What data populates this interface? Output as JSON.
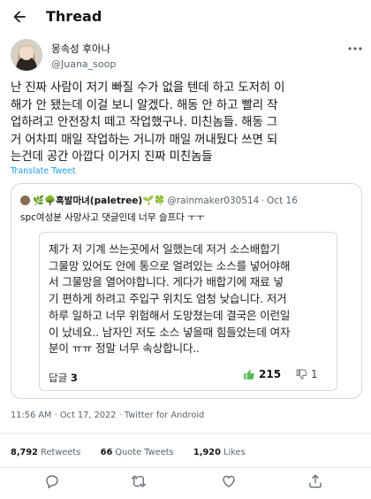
{
  "header": {
    "title": "Thread",
    "back_icon": "arrow-left-icon"
  },
  "author": {
    "display_name": "몽속성 후아나",
    "handle": "@Juana_soop"
  },
  "tweet": {
    "lines": [
      "난 진짜 사람이 저기 빠질 수가 없을 텐데 하고 도저히 이",
      "해가 안 됐는데 이걸 보니 알겠다. 해동 안 하고 빨리 작",
      "업하려고 안전장치 떼고 작업했구나. 미친놈들. 해동 그",
      "거 어차피 매일 작업하는 거니까 매일 꺼내뒀다 쓰면 되",
      "는건데 공간 아깝다 이거지 진짜 미친놈들"
    ],
    "translate_label": "Translate Tweet"
  },
  "quote": {
    "name": "🌿🌳흑발마녀(paletree)🌱🍀",
    "handle": "@rainmaker030514",
    "date": "· Oct 16",
    "text": "spc여성분 사망사고 댓글인데 너무 슬프다 ㅜㅜ",
    "card": {
      "lines": [
        "제가 저 기계 쓰는곳에서 일했는데 저거 소스배합기",
        "그물망 있어도 안에 통으로 얼려있는 소스를 넣어야해",
        "서 그물망을 열어야합니다. 게다가 배합기에 재료 넣",
        "기 편하게 하려고 주입구 위치도 엄청 낮습니다. 저거",
        "하루 일하고 너무 위험해서 도망쳤는데 결국은 이런일",
        "이 났네요.. 남자인 저도 소스 넣을때 힘들었는데 여자",
        "분이 ㅠㅠ 정말 너무 속상합니다.."
      ],
      "reply_label": "답글",
      "reply_count": "3",
      "like_count": "215",
      "dislike_count": "1",
      "like_color": "#5cb85c"
    }
  },
  "timestamp": "11:56 AM · Oct 17, 2022 · Twitter for Android",
  "stats": {
    "retweets_count": "8,792",
    "retweets_label": "Retweets",
    "quotes_count": "66",
    "quotes_label": "Quote Tweets",
    "likes_count": "1,920",
    "likes_label": "Likes"
  },
  "actions": [
    "reply-icon",
    "retweet-icon",
    "like-icon",
    "share-icon"
  ],
  "colors": {
    "accent": "#1d9bf0",
    "secondary_text": "#536471",
    "border": "#cfd9de"
  }
}
